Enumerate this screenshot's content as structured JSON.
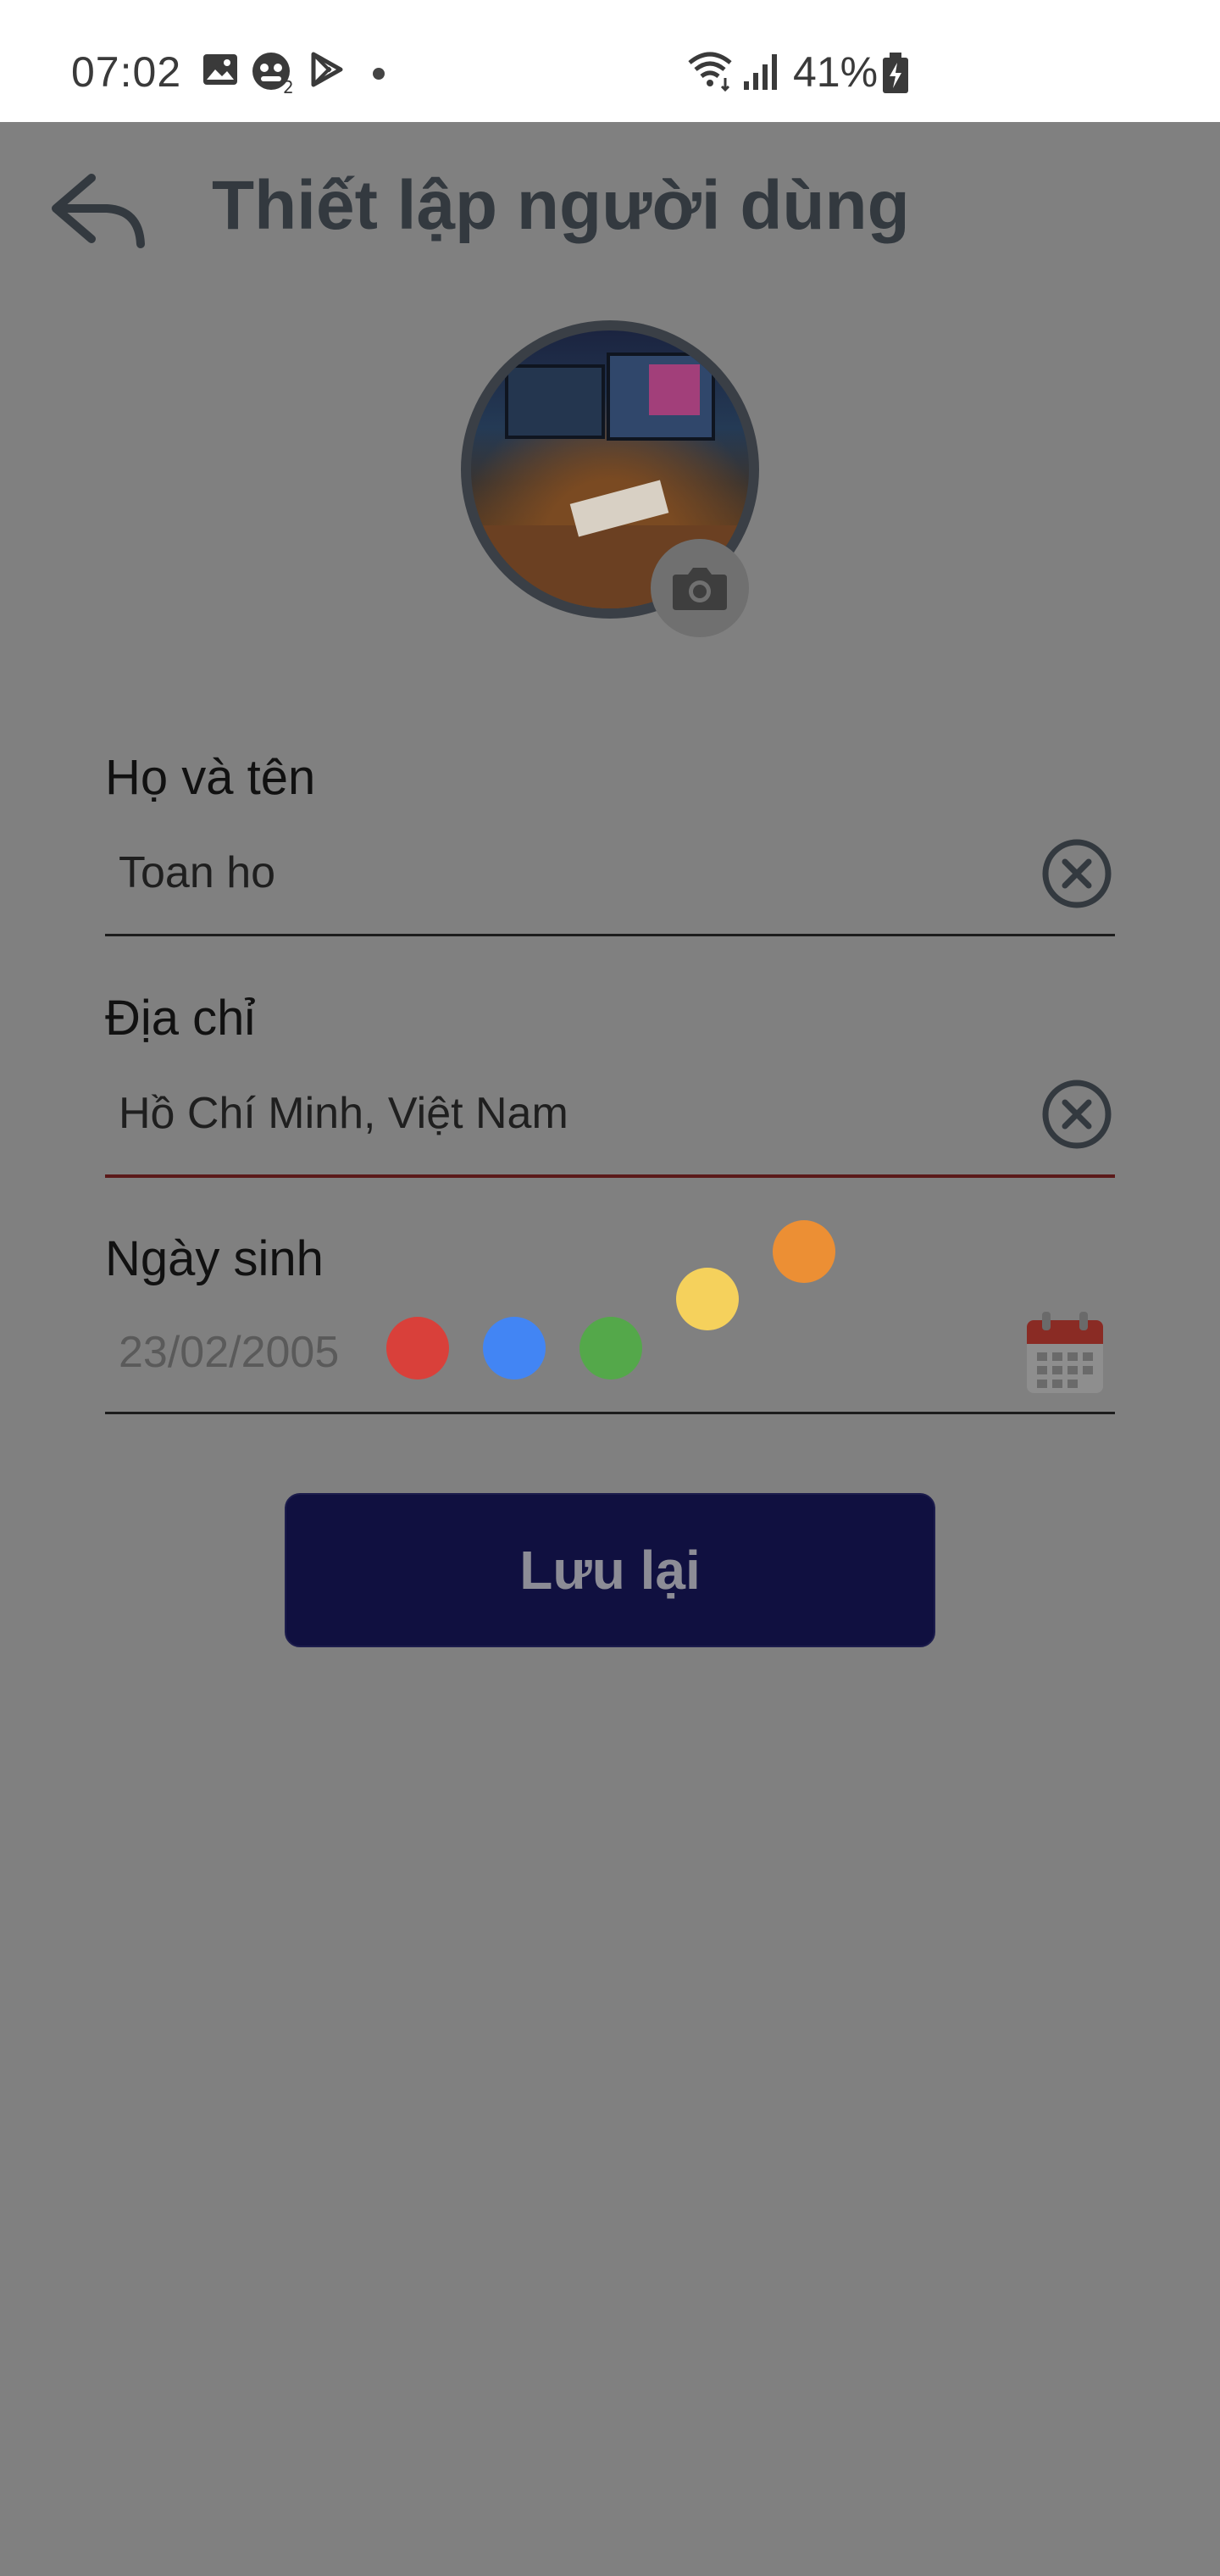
{
  "status_bar": {
    "time": "07:02",
    "battery": "41%",
    "icons": [
      "gallery-icon",
      "app-notification-icon",
      "play-store-icon",
      "wifi-icon",
      "signal-icon",
      "battery-charging-icon"
    ]
  },
  "header": {
    "title": "Thiết lập người dùng",
    "back_icon": "back-arrow-icon"
  },
  "avatar": {
    "camera_icon": "camera-icon"
  },
  "form": {
    "name": {
      "label": "Họ và tên",
      "value": "Toan ho"
    },
    "address": {
      "label": "Địa chỉ",
      "value": "Hồ Chí Minh, Việt Nam"
    },
    "birthday": {
      "label": "Ngày sinh",
      "value": "23/02/2005"
    }
  },
  "loading_dots": {
    "colors": [
      "#d9403a",
      "#4285f4",
      "#54a84a",
      "#f5d15c",
      "#ec8f34"
    ]
  },
  "save_button": {
    "label": "Lưu lại"
  },
  "colors": {
    "overlay": "#808080",
    "button_bg": "#101040",
    "title": "#33393f"
  }
}
